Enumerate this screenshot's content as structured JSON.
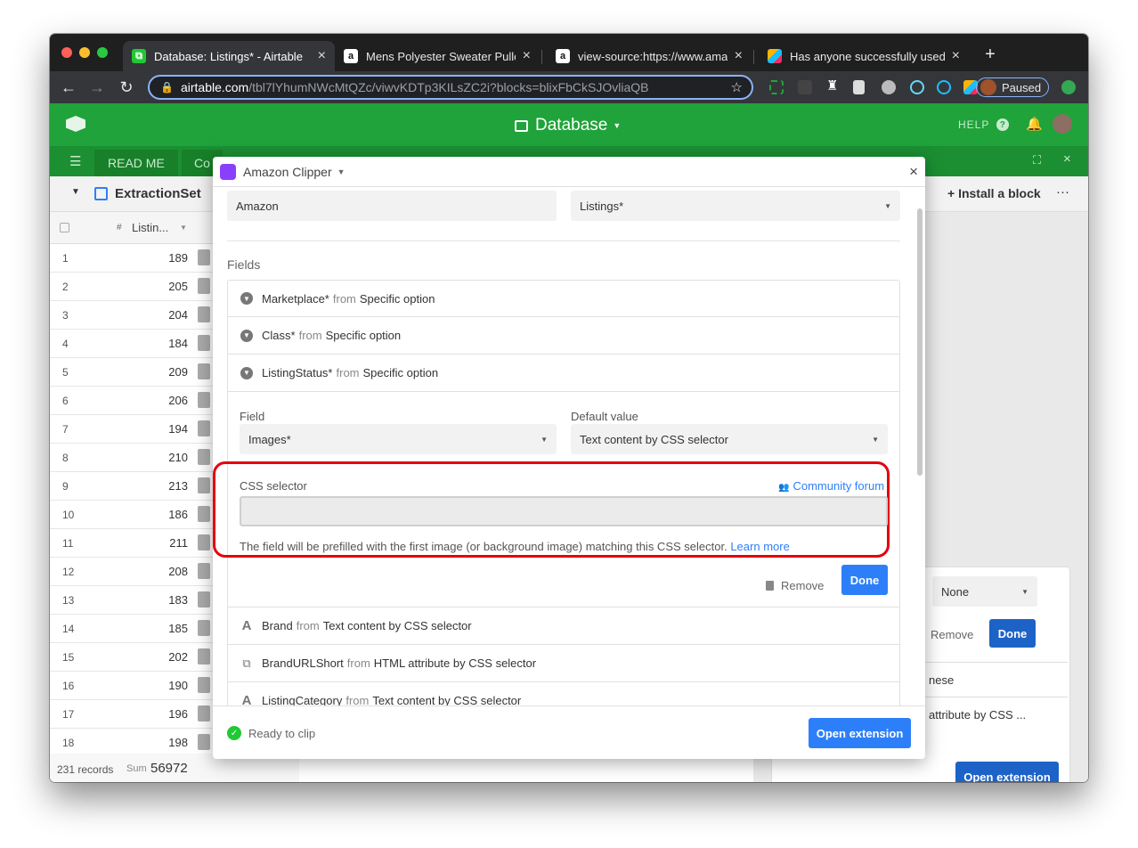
{
  "browser": {
    "tabs": [
      {
        "title": "Database: Listings* - Airtable",
        "active": true
      },
      {
        "title": "Mens Polyester Sweater Pullov",
        "active": false
      },
      {
        "title": "view-source:https://www.amaz",
        "active": false
      },
      {
        "title": "Has anyone successfully used",
        "active": false
      }
    ],
    "url_host": "airtable.com",
    "url_path": "/tbl7lYhumNWcMtQZc/viwvKDTp3KILsZC2i?blocks=blixFbCkSJOvliaQB",
    "profile_status": "Paused",
    "colors": {
      "frame": "#1f1f1f",
      "toolbar": "#35363a",
      "focus": "#8ab4f8"
    }
  },
  "airtable": {
    "base_title": "Database",
    "help_label": "HELP",
    "tables": [
      "READ ME",
      "Co"
    ],
    "view_name": "ExtractionSet",
    "install_block_label": "Install a block",
    "column_header": "Listin...",
    "rows": [
      {
        "n": "1",
        "v": "189"
      },
      {
        "n": "2",
        "v": "205"
      },
      {
        "n": "3",
        "v": "204"
      },
      {
        "n": "4",
        "v": "184"
      },
      {
        "n": "5",
        "v": "209"
      },
      {
        "n": "6",
        "v": "206"
      },
      {
        "n": "7",
        "v": "194"
      },
      {
        "n": "8",
        "v": "210"
      },
      {
        "n": "9",
        "v": "213"
      },
      {
        "n": "10",
        "v": "186"
      },
      {
        "n": "11",
        "v": "211"
      },
      {
        "n": "12",
        "v": "208"
      },
      {
        "n": "13",
        "v": "183"
      },
      {
        "n": "14",
        "v": "185"
      },
      {
        "n": "15",
        "v": "202"
      },
      {
        "n": "16",
        "v": "190"
      },
      {
        "n": "17",
        "v": "196"
      },
      {
        "n": "18",
        "v": "198"
      }
    ],
    "records_count": "231 records",
    "sum_label": "Sum",
    "sum_value": "56972",
    "behind": {
      "select_value": "None",
      "remove_label": "Remove",
      "done_label": "Done",
      "row1": "nese",
      "row2": "attribute by CSS ...",
      "open_extension": "Open extension"
    },
    "colors": {
      "brand": "#20a33a",
      "brand_dark": "#1b8f32"
    }
  },
  "modal": {
    "title": "Amazon Clipper",
    "top_left_value": "Amazon",
    "top_right_value": "Listings*",
    "fields_heading": "Fields",
    "from_word": "from",
    "field_rows_top": [
      {
        "name": "Marketplace*",
        "source": "Specific option",
        "icon": "dropdown-icon"
      },
      {
        "name": "Class*",
        "source": "Specific option",
        "icon": "dropdown-icon"
      },
      {
        "name": "ListingStatus*",
        "source": "Specific option",
        "icon": "dropdown-icon"
      }
    ],
    "expanded": {
      "field_label": "Field",
      "field_value": "Images*",
      "default_label": "Default value",
      "default_value": "Text content by CSS selector",
      "css_label": "CSS selector",
      "community_label": "Community forum",
      "css_value": "",
      "help_text": "The field will be prefilled with the first image (or background image) matching this CSS selector.",
      "learn_more": "Learn more",
      "remove_label": "Remove",
      "done_label": "Done"
    },
    "field_rows_bottom": [
      {
        "name": "Brand",
        "source": "Text content by CSS selector",
        "icon": "text-icon"
      },
      {
        "name": "BrandURLShort",
        "source": "HTML attribute by CSS selector",
        "icon": "link-icon"
      },
      {
        "name": "ListingCategory",
        "source": "Text content by CSS selector",
        "icon": "text-icon"
      }
    ],
    "footer_status": "Ready to clip",
    "open_extension_label": "Open extension",
    "colors": {
      "primary": "#2d7ff9",
      "highlight": "#e4000f",
      "success": "#20c933"
    }
  }
}
